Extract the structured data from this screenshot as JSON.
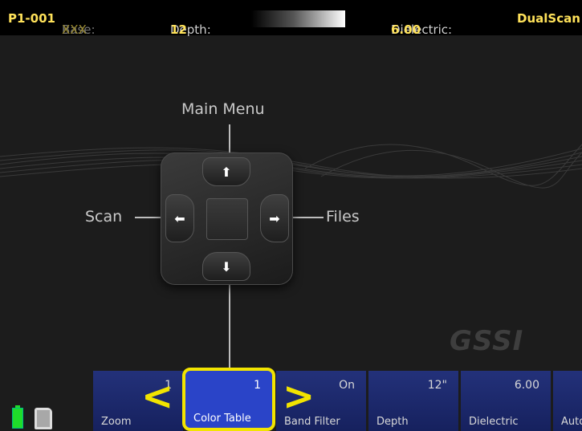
{
  "status": {
    "file": "P1-001",
    "base_label": "Base:",
    "base_value": "XXX",
    "depth_label": "Depth:",
    "depth_value": "12",
    "dielectric_label": "Dielectric:",
    "dielectric_value": "6.00",
    "mode": "DualScan"
  },
  "nav": {
    "up": "Main Menu",
    "left": "Scan",
    "right": "Files"
  },
  "logo": "GSSI",
  "menu": [
    {
      "name": "Zoom",
      "value": "1"
    },
    {
      "name": "Color Table",
      "value": "1",
      "selected": true
    },
    {
      "name": "Band Filter",
      "value": "On"
    },
    {
      "name": "Depth",
      "value": "12\""
    },
    {
      "name": "Dielectric",
      "value": "6.00"
    },
    {
      "name": "Auto",
      "value": ""
    }
  ],
  "colors": {
    "accent": "#f2e400",
    "tile": "#1c2a6e",
    "selected": "#2a44c8",
    "battery": "#1fdc2a"
  }
}
